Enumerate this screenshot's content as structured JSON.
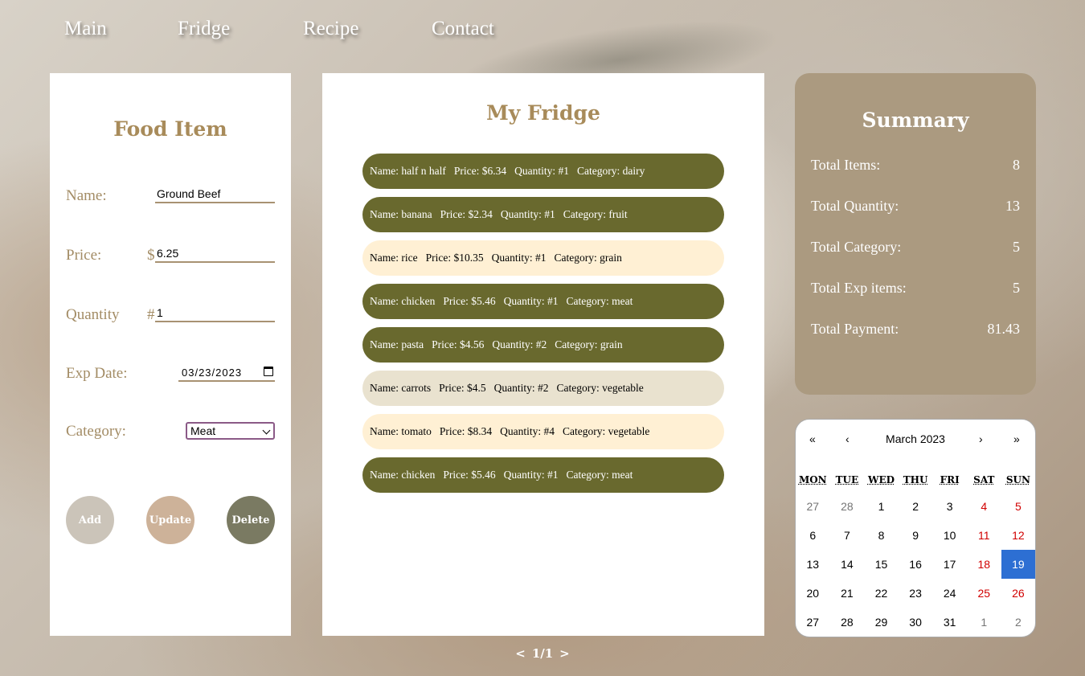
{
  "nav": {
    "items": [
      "Main",
      "Fridge",
      "Recipe",
      "Contact"
    ]
  },
  "food_form": {
    "title": "Food Item",
    "name_label": "Name:",
    "name_value": "Ground Beef",
    "price_label": "Price:",
    "price_prefix": "$",
    "price_value": "6.25",
    "quantity_label": "Quantity",
    "quantity_prefix": "#",
    "quantity_value": "1",
    "exp_label": "Exp Date:",
    "exp_value": "03/23/2023",
    "category_label": "Category:",
    "category_value": "Meat",
    "buttons": {
      "add": "Add",
      "update": "Update",
      "delete": "Delete"
    },
    "colors": {
      "add": "#cbc4b9",
      "update": "#cdb299",
      "delete": "#7a7a62"
    }
  },
  "fridge": {
    "title": "My Fridge",
    "items": [
      {
        "name": "Name: half n half",
        "price": "Price: $6.34",
        "quantity": "Quantity: #1",
        "category": "Category: dairy",
        "bg": "#69692e",
        "fg": "#ffffff"
      },
      {
        "name": "Name: banana",
        "price": "Price: $2.34",
        "quantity": "Quantity: #1",
        "category": "Category: fruit",
        "bg": "#69692e",
        "fg": "#ffffff"
      },
      {
        "name": "Name: rice",
        "price": "Price: $10.35",
        "quantity": "Quantity: #1",
        "category": "Category: grain",
        "bg": "#fff0d4",
        "fg": "#000000"
      },
      {
        "name": "Name: chicken",
        "price": "Price: $5.46",
        "quantity": "Quantity: #1",
        "category": "Category: meat",
        "bg": "#69692e",
        "fg": "#ffffff"
      },
      {
        "name": "Name: pasta",
        "price": "Price: $4.56",
        "quantity": "Quantity: #2",
        "category": "Category: grain",
        "bg": "#69692e",
        "fg": "#ffffff"
      },
      {
        "name": "Name: carrots",
        "price": "Price: $4.5",
        "quantity": "Quantity: #2",
        "category": "Category: vegetable",
        "bg": "#e9e2cf",
        "fg": "#000000"
      },
      {
        "name": "Name: tomato",
        "price": "Price: $8.34",
        "quantity": "Quantity: #4",
        "category": "Category: vegetable",
        "bg": "#fff0d4",
        "fg": "#000000"
      },
      {
        "name": "Name: chicken",
        "price": "Price: $5.46",
        "quantity": "Quantity: #1",
        "category": "Category: meat",
        "bg": "#69692e",
        "fg": "#ffffff"
      }
    ],
    "pager": {
      "prev": "<",
      "page": "1/1",
      "next": ">"
    }
  },
  "summary": {
    "title": "Summary",
    "rows": [
      {
        "label": "Total Items:",
        "value": "8"
      },
      {
        "label": "Total Quantity:",
        "value": "13"
      },
      {
        "label": "Total Category:",
        "value": "5"
      },
      {
        "label": "Total Exp items:",
        "value": "5"
      },
      {
        "label": "Total Payment:",
        "value": "81.43"
      }
    ]
  },
  "calendar": {
    "month_label": "March 2023",
    "nav": {
      "prev_year": "«",
      "prev_month": "‹",
      "next_month": "›",
      "next_year": "»"
    },
    "weekdays": [
      "MON",
      "TUE",
      "WED",
      "THU",
      "FRI",
      "SAT",
      "SUN"
    ],
    "weeks": [
      [
        "27",
        "28",
        "1",
        "2",
        "3",
        "4",
        "5"
      ],
      [
        "6",
        "7",
        "8",
        "9",
        "10",
        "11",
        "12"
      ],
      [
        "13",
        "14",
        "15",
        "16",
        "17",
        "18",
        "19"
      ],
      [
        "20",
        "21",
        "22",
        "23",
        "24",
        "25",
        "26"
      ],
      [
        "27",
        "28",
        "29",
        "30",
        "31",
        "1",
        "2"
      ]
    ],
    "selected_day": "19",
    "selected_color": "#2d6fd3"
  }
}
